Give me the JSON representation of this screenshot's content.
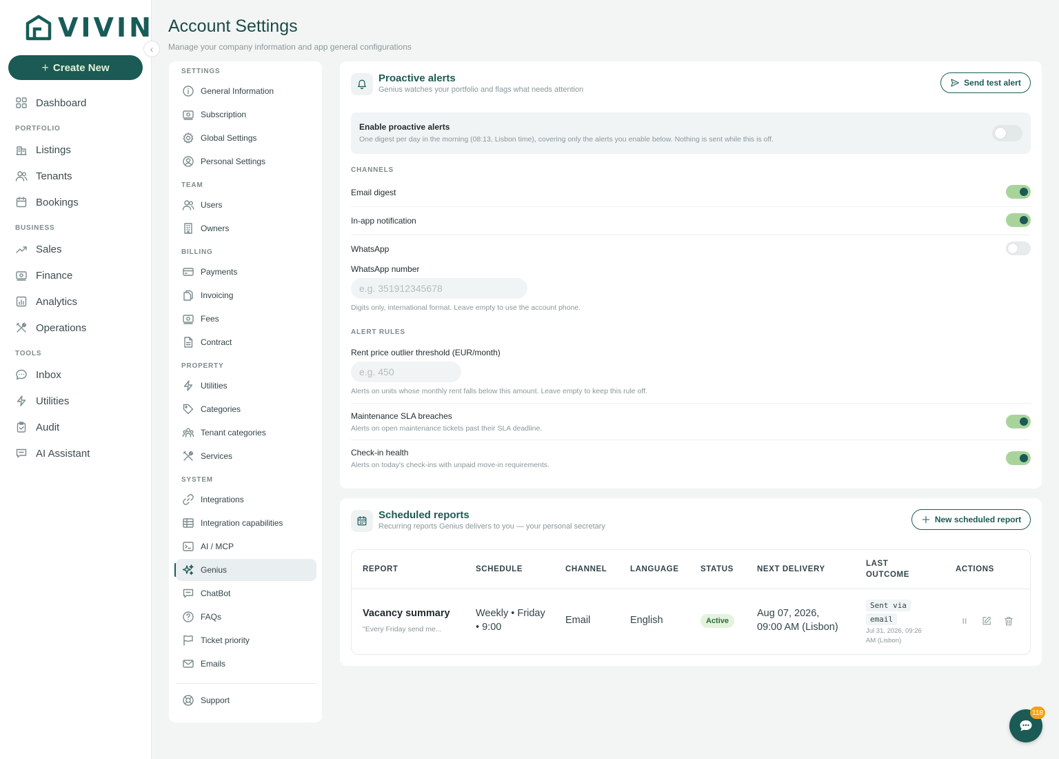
{
  "brand": {
    "name": "VIVIN",
    "accent": "#1b5a55",
    "accent_light": "#a8d49c"
  },
  "leftnav": {
    "create_label": "Create New",
    "dashboard": "Dashboard",
    "sections": {
      "portfolio": "PORTFOLIO",
      "business": "BUSINESS",
      "tools": "TOOLS"
    },
    "portfolio": [
      "Listings",
      "Tenants",
      "Bookings"
    ],
    "business": [
      "Sales",
      "Finance",
      "Analytics",
      "Operations"
    ],
    "tools": [
      "Inbox",
      "Utilities",
      "Audit",
      "AI Assistant"
    ]
  },
  "header": {
    "title": "Account Settings",
    "subtitle": "Manage your company information and app general configurations"
  },
  "settings_menu": {
    "sections": {
      "settings": "SETTINGS",
      "team": "TEAM",
      "billing": "BILLING",
      "property": "PROPERTY",
      "system": "SYSTEM"
    },
    "settings": [
      "General Information",
      "Subscription",
      "Global Settings",
      "Personal Settings"
    ],
    "team": [
      "Users",
      "Owners"
    ],
    "billing": [
      "Payments",
      "Invoicing",
      "Fees",
      "Contract"
    ],
    "property": [
      "Utilities",
      "Categories",
      "Tenant categories",
      "Services"
    ],
    "system": [
      "Integrations",
      "Integration capabilities",
      "AI / MCP",
      "Genius",
      "ChatBot",
      "FAQs",
      "Ticket priority",
      "Emails"
    ],
    "support": "Support",
    "active": "Genius"
  },
  "proactive": {
    "title": "Proactive alerts",
    "subtitle": "Genius watches your portfolio and flags what needs attention",
    "test_button": "Send test alert",
    "enable_title": "Enable proactive alerts",
    "enable_desc": "One digest per day in the morning (08:13, Lisbon time), covering only the alerts you enable below. Nothing is sent while this is off.",
    "enabled": false,
    "channels_label": "CHANNELS",
    "channels": {
      "email": "Email digest",
      "inapp": "In-app notification",
      "whatsapp": "WhatsApp"
    },
    "channel_state": {
      "email": true,
      "inapp": true,
      "whatsapp": false
    },
    "whatsapp_number_label": "WhatsApp number",
    "whatsapp_placeholder": "e.g. 351912345678",
    "whatsapp_hint": "Digits only, international format. Leave empty to use the account phone.",
    "rules_label": "ALERT RULES",
    "rent_label": "Rent price outlier threshold (EUR/month)",
    "rent_placeholder": "e.g. 450",
    "rent_hint": "Alerts on units whose monthly rent falls below this amount. Leave empty to keep this rule off.",
    "sla_title": "Maintenance SLA breaches",
    "sla_desc": "Alerts on open maintenance tickets past their SLA deadline.",
    "sla_enabled": true,
    "checkin_title": "Check-in health",
    "checkin_desc": "Alerts on today's check-ins with unpaid move-in requirements.",
    "checkin_enabled": true
  },
  "scheduled": {
    "title": "Scheduled reports",
    "subtitle": "Recurring reports Genius delivers to you — your personal secretary",
    "new_button": "New scheduled report",
    "columns": {
      "report": "REPORT",
      "schedule": "SCHEDULE",
      "channel": "CHANNEL",
      "language": "LANGUAGE",
      "status": "STATUS",
      "next": "NEXT DELIVERY",
      "last_1": "LAST",
      "last_2": "OUTCOME",
      "actions": "ACTIONS"
    },
    "row": {
      "name": "Vacancy summary",
      "quote": "\"Every Friday send me...",
      "schedule_1": "Weekly • Friday",
      "schedule_2": "• 9:00",
      "channel": "Email",
      "language": "English",
      "status": "Active",
      "next_1": "Aug 07, 2026,",
      "next_2": "09:00 AM (Lisbon)",
      "outcome_1": "Sent via",
      "outcome_2": "email",
      "outcome_date_1": "Jul 31, 2026, 09:26",
      "outcome_date_2": "AM (Lisbon)"
    }
  },
  "chat": {
    "badge": "118"
  }
}
